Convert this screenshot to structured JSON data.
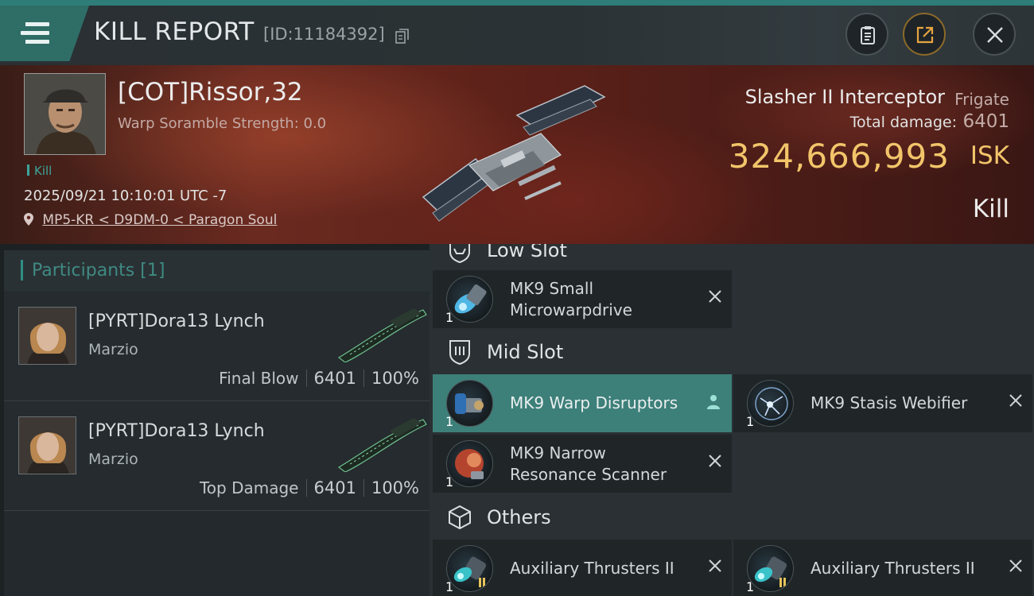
{
  "header": {
    "title": "KILL REPORT",
    "report_id": "[ID:11184392]",
    "icons": [
      "menu-icon",
      "copy-icon",
      "clipboard-icon",
      "export-icon",
      "close-icon"
    ]
  },
  "victim": {
    "pilot_name": "[COT]Rissor,32",
    "scramble_strength": "Warp Soramble Strength: 0.0",
    "tag": "Kill",
    "timestamp": "2025/09/21 10:10:01 UTC -7",
    "location": "MP5-KR < D9DM-0 < Paragon Soul",
    "ship_name": "Slasher II Interceptor",
    "ship_class": "Frigate",
    "total_damage_label": "Total damage:",
    "total_damage": "6401",
    "isk_value": "324,666,993",
    "isk_unit": "ISK",
    "result": "Kill"
  },
  "participants": {
    "title": "Participants",
    "count": "[1]",
    "rows": [
      {
        "name": "[PYRT]Dora13 Lynch",
        "ship": "Marzio",
        "label": "Final Blow",
        "damage": "6401",
        "percent": "100%"
      },
      {
        "name": "[PYRT]Dora13 Lynch",
        "ship": "Marzio",
        "label": "Top Damage",
        "damage": "6401",
        "percent": "100%"
      }
    ]
  },
  "fitting": {
    "low_slot": {
      "label": "Low Slot",
      "modules": [
        {
          "name_line1": "MK9 Small",
          "name_line2": "Microwarpdrive",
          "qty": "1"
        }
      ]
    },
    "mid_slot": {
      "label": "Mid Slot",
      "modules": [
        {
          "name_line1": "MK9 Warp Disruptors",
          "qty": "1",
          "active": true
        },
        {
          "name_line1": "MK9 Stasis Webifier",
          "qty": "1"
        },
        {
          "name_line1": "MK9 Narrow",
          "name_line2": "Resonance Scanner",
          "qty": "1"
        }
      ]
    },
    "others": {
      "label": "Others",
      "modules": [
        {
          "name_line1": "Auxiliary Thrusters II",
          "qty": "1"
        },
        {
          "name_line1": "Auxiliary Thrusters II",
          "qty": "1"
        }
      ]
    }
  },
  "colors": {
    "accent_teal": "#2e7d78",
    "isk_gold": "#f2c56a",
    "active_module": "#3d7f79"
  }
}
